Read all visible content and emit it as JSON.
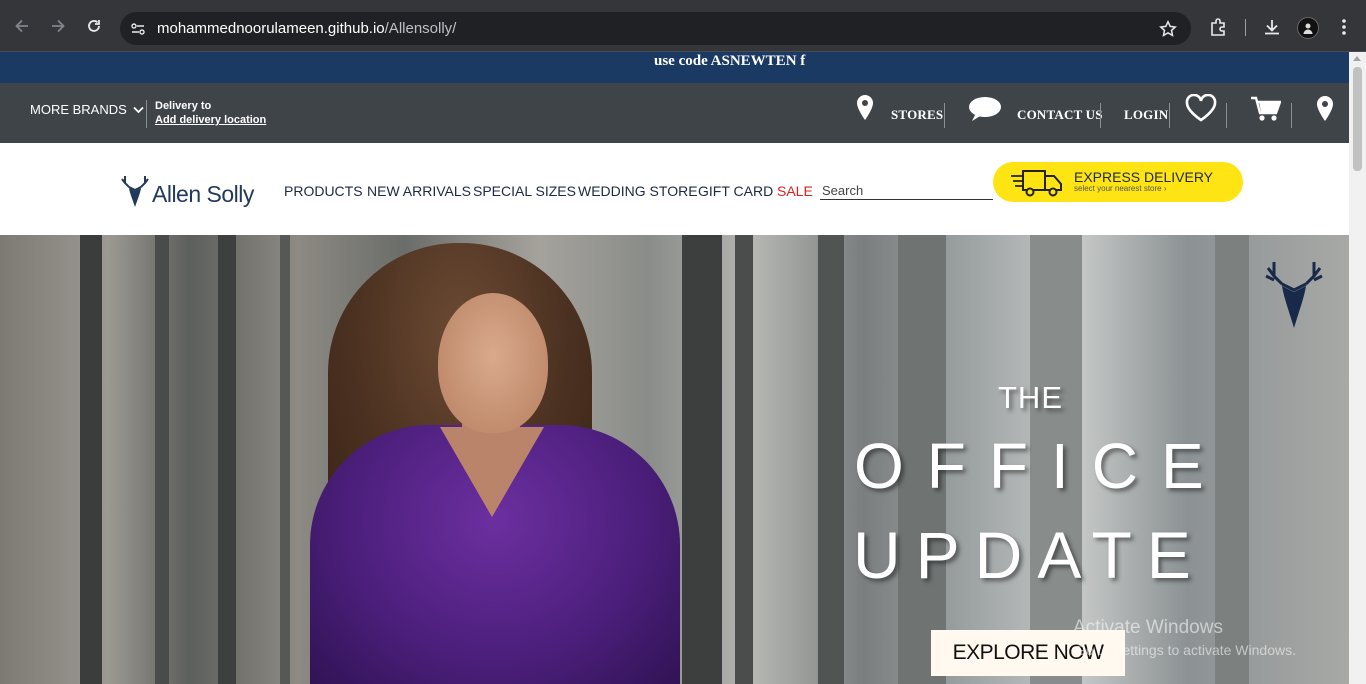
{
  "browser": {
    "url_host": "mohammednoorulameen.github.io",
    "url_path": "/Allensolly/"
  },
  "promo": {
    "text": "use code ASNEWTEN f"
  },
  "util": {
    "more_brands": "MORE BRANDS",
    "delivery_to": "Delivery to",
    "add_location": "Add delivery location",
    "stores": "STORES",
    "contact": "CONTACT US",
    "login": "LOGIN"
  },
  "header": {
    "logo": "Allen Solly",
    "menu": [
      "PRODUCTS",
      "NEW ARRIVALS",
      "SPECIAL SIZES",
      "WEDDING STORE",
      "GIFT CARD",
      "SALE"
    ],
    "search_placeholder": "Search",
    "express_title": "EXPRESS DELIVERY",
    "express_sub": "select your nearest store ›"
  },
  "hero": {
    "line1": "THE",
    "line2": "OFFICE",
    "line3": "UPDATE",
    "cta": "EXPLORE NOW"
  },
  "watermark": {
    "title": "Activate Windows",
    "sub": "Go to Settings to activate Windows."
  },
  "colors": {
    "promo_bg": "#1b3a63",
    "util_bg": "#3f4448",
    "express_bg": "#ffe414",
    "sale": "#e0201c",
    "shirt": "#4c1f7c"
  },
  "icons": [
    "back-icon",
    "forward-icon",
    "reload-icon",
    "site-info-icon",
    "bookmark-star-icon",
    "extensions-icon",
    "download-icon",
    "profile-icon",
    "menu-dots-icon",
    "chevron-down-icon",
    "location-pin-icon",
    "chat-bubble-icon",
    "heart-icon",
    "cart-icon",
    "stag-logo-icon",
    "delivery-truck-icon"
  ]
}
